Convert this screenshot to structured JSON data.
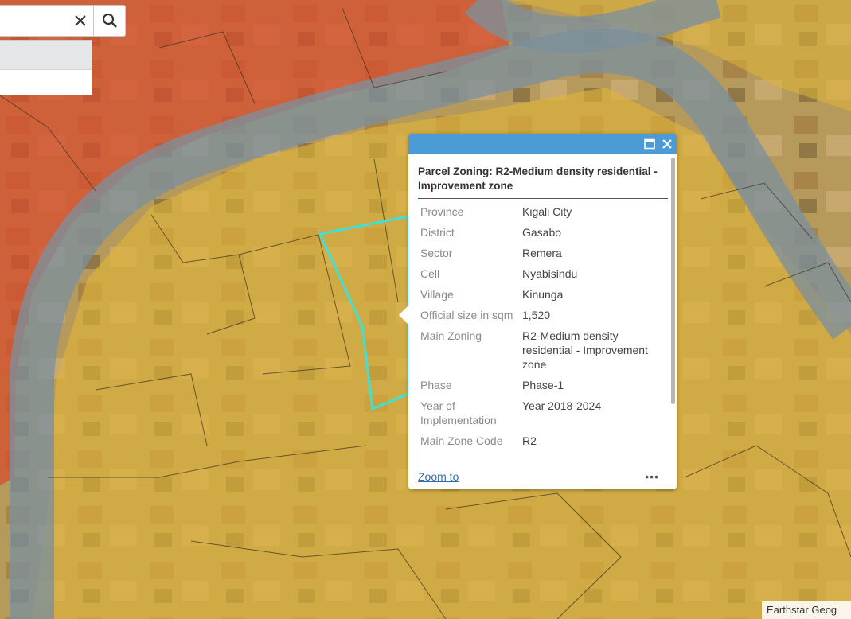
{
  "search": {
    "placeholder": "",
    "clear_icon": "close-icon",
    "search_icon": "search-icon"
  },
  "popup": {
    "title": "Parcel Zoning: R2-Medium density residential - Improvement zone",
    "header_color": "#4a9bd6",
    "maximize_icon": "maximize-icon",
    "close_icon": "close-icon",
    "attributes": [
      {
        "key": "Province",
        "value": "Kigali City"
      },
      {
        "key": "District",
        "value": "Gasabo"
      },
      {
        "key": "Sector",
        "value": "Remera"
      },
      {
        "key": "Cell",
        "value": "Nyabisindu"
      },
      {
        "key": "Village",
        "value": "Kinunga"
      },
      {
        "key": "Official size in sqm",
        "value": "1,520"
      },
      {
        "key": "Main Zoning",
        "value": "R2-Medium density residential - Improvement zone"
      },
      {
        "key": "Phase",
        "value": "Phase-1"
      },
      {
        "key": "Year of Implementation",
        "value": "Year 2018-2024"
      },
      {
        "key": "Main Zone Code",
        "value": "R2"
      }
    ],
    "zoom_to_label": "Zoom to",
    "more_label": "•••"
  },
  "map": {
    "attribution": "Earthstar Geog",
    "selection_color": "#3ee0d8",
    "zone_colors": {
      "residential_yellow": "#e0b437",
      "red_zone": "#d8492e",
      "road_buffer": "#7d8f9c"
    }
  }
}
